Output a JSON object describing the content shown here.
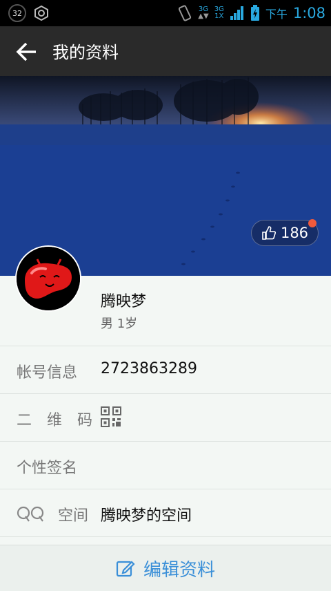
{
  "status_bar": {
    "badge": "32",
    "net_top": "3G",
    "net_mid": "3G",
    "net_bottom": "1X",
    "ampm": "下午",
    "time": "1:08"
  },
  "header": {
    "title": "我的资料"
  },
  "cover": {
    "like_count": "186"
  },
  "profile": {
    "name": "腾映梦",
    "sub": "男 1岁"
  },
  "rows": {
    "account_label": "帐号信息",
    "account_value": "2723863289",
    "qr_label": "二　维　码",
    "signature_label": "个性签名",
    "space_label": "空间",
    "space_value": "腾映梦的空间"
  },
  "footer": {
    "edit_label": "编辑资料"
  },
  "colors": {
    "accent": "#3a8fd8",
    "status_blue": "#29a9e0",
    "dark_bar": "#2a2a2a",
    "like_dot": "#f05a3c"
  }
}
